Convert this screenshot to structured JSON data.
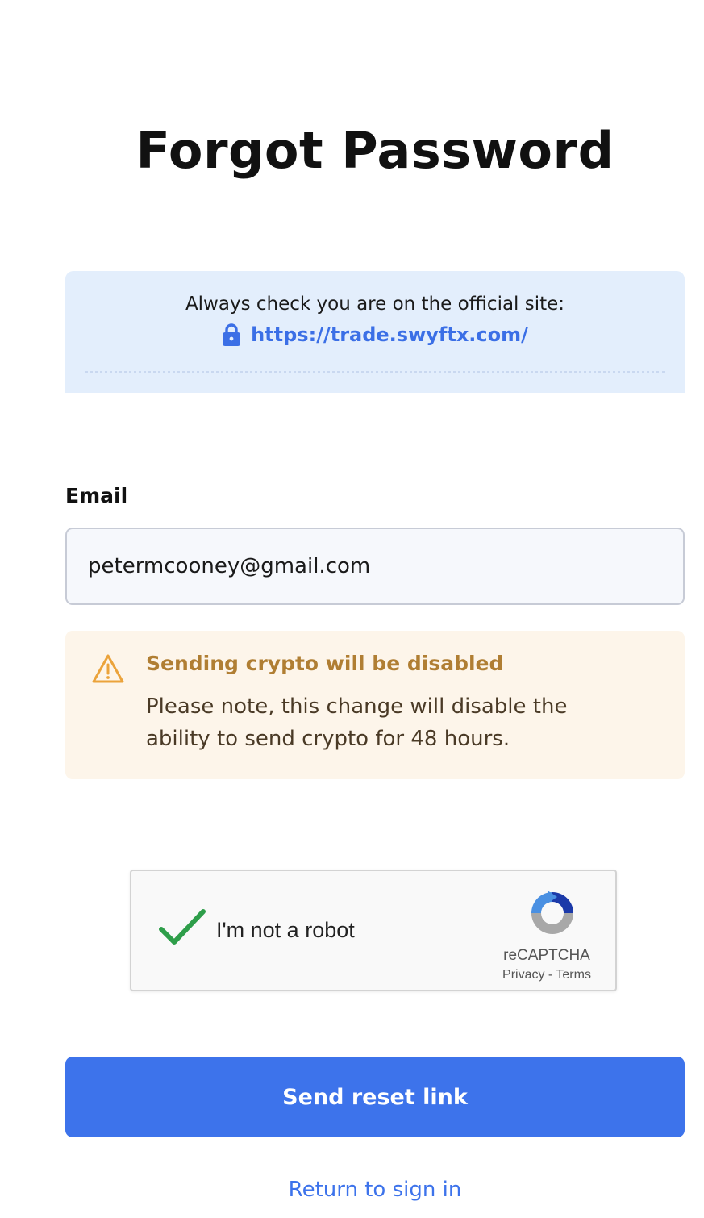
{
  "page": {
    "title": "Forgot Password"
  },
  "notice": {
    "text": "Always check you are on the official site:",
    "url": "https://trade.swyftx.com/",
    "icon": "lock-icon"
  },
  "form": {
    "email_label": "Email",
    "email_value": "petermcooney@gmail.com"
  },
  "warning": {
    "icon": "warning-icon",
    "title": "Sending crypto will be disabled",
    "body": "Please note, this change will disable the ability to send crypto for 48 hours."
  },
  "captcha": {
    "label": "I'm not a robot",
    "brand": "reCAPTCHA",
    "privacy": "Privacy",
    "separator": "-",
    "terms": "Terms",
    "checked": true
  },
  "actions": {
    "submit_label": "Send reset link",
    "return_label": "Return to sign in"
  },
  "colors": {
    "accent": "#3d73eb",
    "notice_bg": "#e3eefc",
    "warning_bg": "#fdf5ea",
    "warning_title": "#b07e33"
  }
}
